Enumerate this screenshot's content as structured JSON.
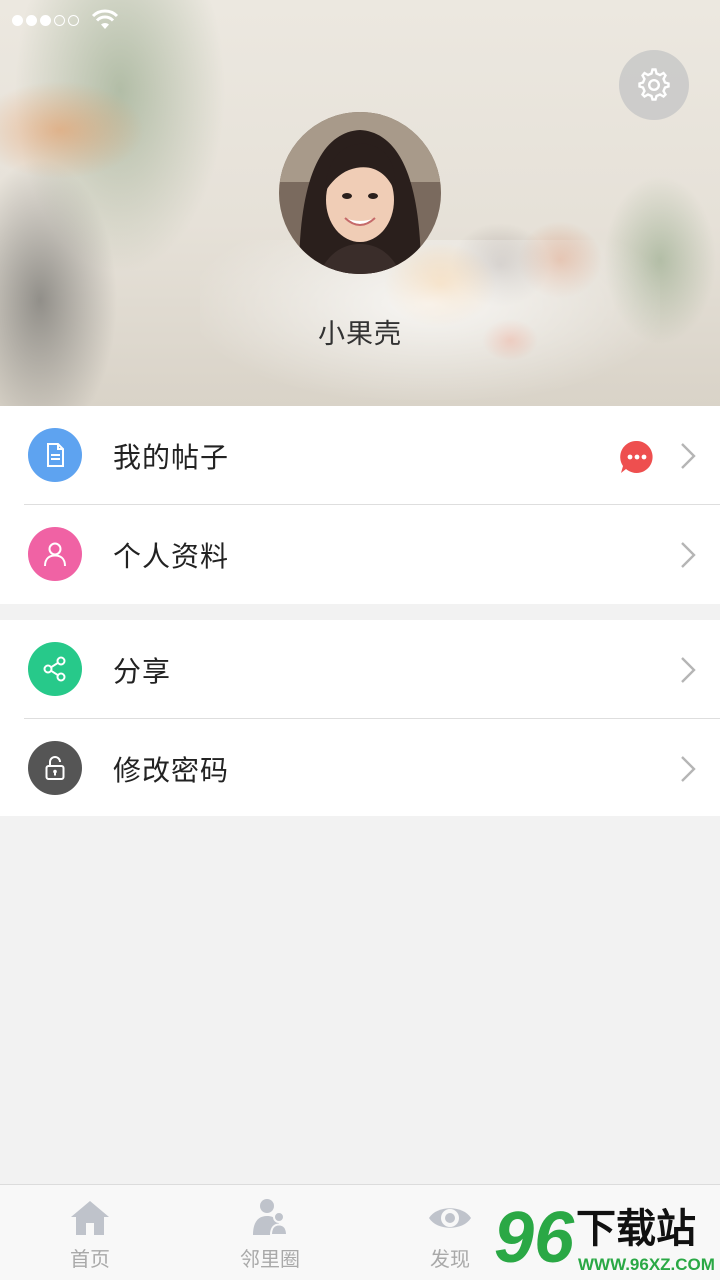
{
  "profile": {
    "username": "小果壳"
  },
  "menu": {
    "group1": [
      {
        "label": "我的帖子",
        "icon": "document-icon",
        "color": "#5ea3f0"
      },
      {
        "label": "个人资料",
        "icon": "person-icon",
        "color": "#f062a4"
      }
    ],
    "group2": [
      {
        "label": "分享",
        "icon": "share-icon",
        "color": "#27c98a"
      },
      {
        "label": "修改密码",
        "icon": "lock-icon",
        "color": "#555555"
      }
    ]
  },
  "badge": {
    "icon": "chat-bubble-icon",
    "color": "#ee4f4f"
  },
  "tabs": [
    {
      "label": "首页",
      "icon": "home-icon"
    },
    {
      "label": "邻里圈",
      "icon": "people-icon"
    },
    {
      "label": "发现",
      "icon": "eye-icon"
    }
  ],
  "watermark": {
    "number": "96",
    "text": "下载站",
    "url": "WWW.96XZ.COM"
  },
  "colors": {
    "tab_inactive": "#a9a9a9",
    "watermark_green": "#2aa845"
  }
}
